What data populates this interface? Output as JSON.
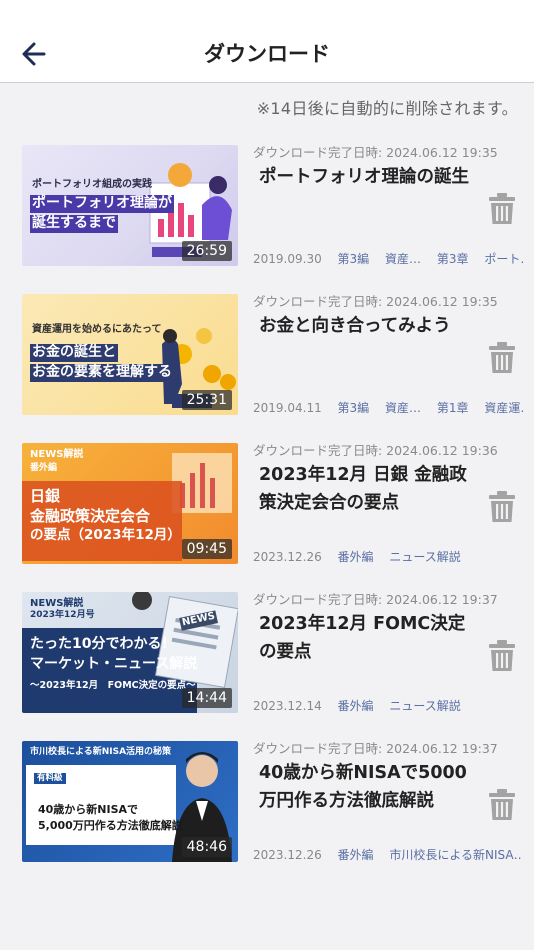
{
  "header": {
    "title": "ダウンロード"
  },
  "notice": "※14日後に自動的に削除されます。",
  "items": [
    {
      "downloaded": "ダウンロード完了日時: 2024.06.12 19:35",
      "title": "ポートフォリオ理論の誕生",
      "duration": "26:59",
      "date": "2019.09.30",
      "tags": [
        "第3編",
        "資産…",
        "第3章",
        "ポート…"
      ],
      "thumb_sub": "ポートフォリオ組成の実践",
      "thumb_main1": "ポートフォリオ理論が",
      "thumb_main2": "誕生するまで"
    },
    {
      "downloaded": "ダウンロード完了日時: 2024.06.12 19:35",
      "title": "お金と向き合ってみよう",
      "duration": "25:31",
      "date": "2019.04.11",
      "tags": [
        "第3編",
        "資産…",
        "第1章",
        "資産運…"
      ],
      "thumb_sub": "資産運用を始めるにあたって",
      "thumb_main1": "お金の誕生と",
      "thumb_main2": "お金の要素を理解する"
    },
    {
      "downloaded": "ダウンロード完了日時: 2024.06.12 19:36",
      "title": "2023年12月 日銀 金融政策決定会合の要点",
      "duration": "09:45",
      "date": "2023.12.26",
      "tags": [
        "番外編",
        "ニュース解説"
      ],
      "thumb_sub": "NEWS解説",
      "thumb_sub2": "番外編",
      "thumb_main1": "日銀",
      "thumb_main2": "金融政策決定会合",
      "thumb_main3": "の要点（2023年12月）"
    },
    {
      "downloaded": "ダウンロード完了日時: 2024.06.12 19:37",
      "title": "2023年12月 FOMC決定の要点",
      "duration": "14:44",
      "date": "2023.12.14",
      "tags": [
        "番外編",
        "ニュース解説"
      ],
      "thumb_sub": "NEWS解説",
      "thumb_sub2": "2023年12月号",
      "thumb_main1": "たった10分でわかる!",
      "thumb_main2": "マーケット・ニュース解説",
      "thumb_main3": "〜2023年12月　FOMC決定の要点〜",
      "thumb_badge": "NEWS"
    },
    {
      "downloaded": "ダウンロード完了日時: 2024.06.12 19:37",
      "title": "40歳から新NISAで5000万円作る方法徹底解説",
      "duration": "48:46",
      "date": "2023.12.26",
      "tags": [
        "番外編",
        "市川校長による新NISA…"
      ],
      "thumb_sub": "市川校長による新NISA活用の秘策",
      "thumb_badge": "有料級",
      "thumb_main1": "40歳から新NISAで",
      "thumb_main2": "5,000万円作る方法徹底解説"
    }
  ]
}
